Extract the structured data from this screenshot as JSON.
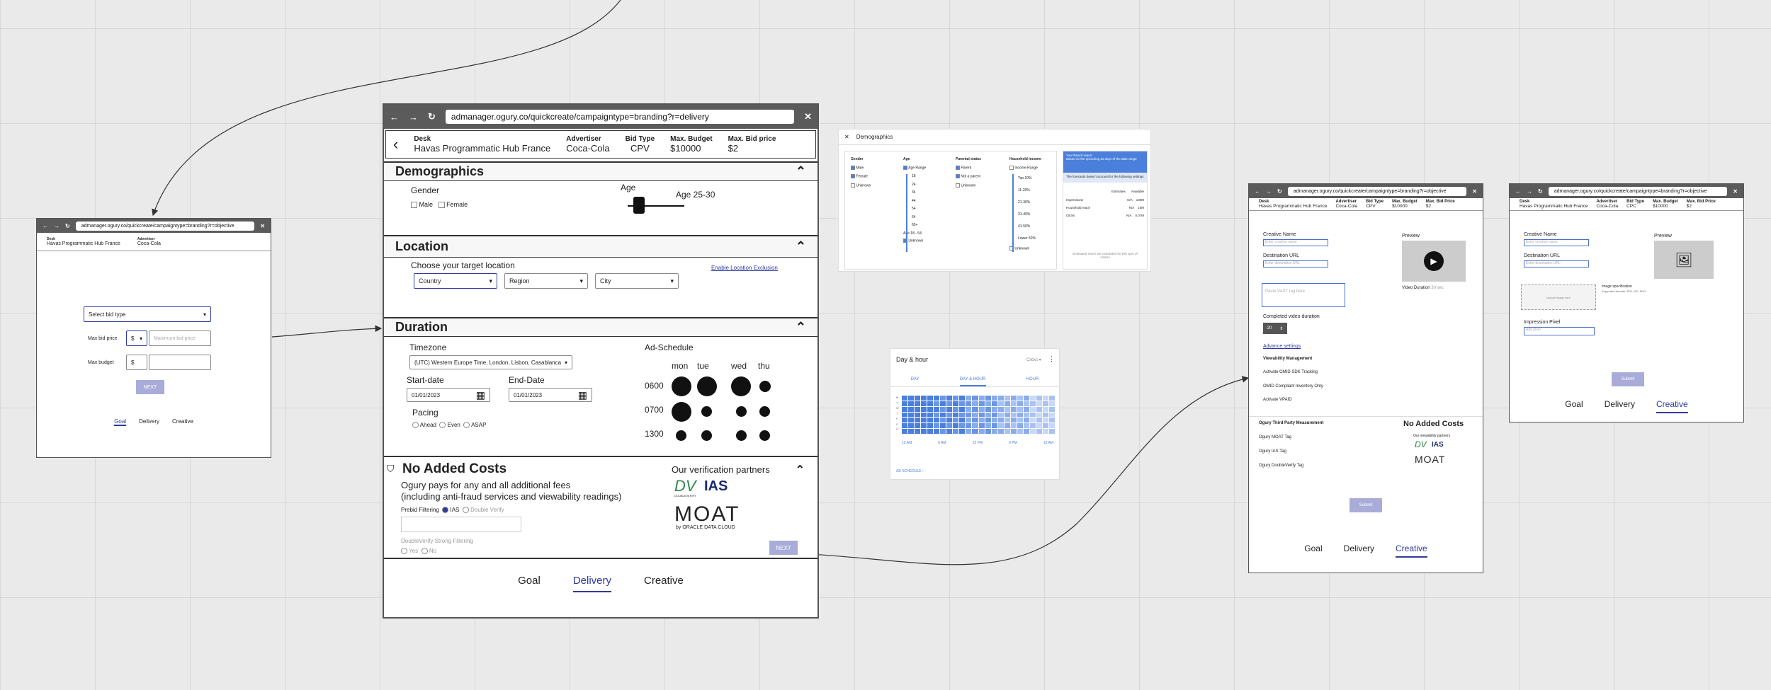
{
  "main": {
    "url": "admanager.ogury.co/quickcreate/campaigntype=branding?r=delivery",
    "header": {
      "desk_label": "Desk",
      "desk": "Havas Programmatic Hub France",
      "adv_label": "Advertiser",
      "adv": "Coca-Cola",
      "bid_label": "Bid Type",
      "bid": "CPV",
      "budget_label": "Max. Budget",
      "budget": "$10000",
      "price_label": "Max. Bid price",
      "price": "$2"
    },
    "demographics": {
      "title": "Demographics",
      "gender_label": "Gender",
      "male": "Male",
      "female": "Female",
      "age_label": "Age",
      "age_value": "Age 25-30"
    },
    "location": {
      "title": "Location",
      "prompt": "Choose your target location",
      "country": "Country",
      "region": "Region",
      "city": "City",
      "exclusion": "Enable Location Exclusion"
    },
    "duration": {
      "title": "Duration",
      "timezone_label": "Timezone",
      "timezone": "(UTC) Western Europe Time, London, Lisbon, Casablanca",
      "start_label": "Start-date",
      "start": "01/01/2023",
      "end_label": "End-Date",
      "end": "01/01/2023",
      "pacing_label": "Pacing",
      "ahead": "Ahead",
      "even": "Even",
      "asap": "ASAP",
      "schedule_label": "Ad-Schedule",
      "days": [
        "mon",
        "tue",
        "wed",
        "thu"
      ],
      "hours": [
        "0600",
        "0700",
        "1300"
      ]
    },
    "costs": {
      "title": "No Added Costs",
      "line1": "Ogury pays for any and all additional fees",
      "line2": "(including anti-fraud services and viewability readings)",
      "prebid_label": "Prebid Filtering",
      "ias": "IAS",
      "dv": "Double Verify",
      "dv_strong": "DoubleVerify Strong Filtering",
      "yes": "Yes",
      "no": "No",
      "partners": "Our verification partners",
      "dv_logo": "DV",
      "ias_logo": "IAS",
      "dv_sub": "DOUBLEVERIFY",
      "moat": "MOAT",
      "moat_sub": "by ORACLE DATA CLOUD",
      "next": "NEXT"
    },
    "tabs": {
      "goal": "Goal",
      "delivery": "Delivery",
      "creative": "Creative"
    }
  },
  "left": {
    "url": "admanager.ogury.co/quickcreate/campaigntype=branding?r=objective",
    "desk_label": "Desk",
    "desk": "Havas Programmatic Hub France",
    "adv_label": "Advertiser",
    "adv": "Coca-Cola",
    "bid_type": "Select bid type",
    "max_bid_label": "Max bid price",
    "currency": "$",
    "max_bid_ph": "Maximum bid price",
    "max_budget_label": "Max budget",
    "next": "NEXT",
    "tabs": {
      "goal": "Goal",
      "delivery": "Delivery",
      "creative": "Creative"
    }
  },
  "demo_panel": {
    "title": "Demographics",
    "gender_h": "Gender",
    "genders": [
      "Male",
      "Female",
      "Unknown"
    ],
    "age_h": "Age",
    "age_range": "Age Range",
    "ages": [
      "18",
      "24",
      "34",
      "44",
      "54",
      "64",
      "65+"
    ],
    "age_summary": "Age 18 - 54",
    "age_unknown": "Unknown",
    "parental_h": "Parental status",
    "parental": [
      "Parent",
      "Not a parent",
      "Unknown"
    ],
    "income_h": "Household income",
    "income_range": "Income Range",
    "incomes": [
      "Top 10%",
      "11-20%",
      "21-30%",
      "31-40%",
      "41-50%",
      "Lower 50%"
    ],
    "income_unknown": "Unknown",
    "reach_title": "Your Reach report",
    "reach_sub": "Based on the upcoming 30 days of the date range",
    "notice": "The forecasts doesn't account for the following settings",
    "col_a": "Estimates",
    "col_b": "Available",
    "reach_rows": [
      [
        "Impressions",
        "N/A",
        "100M"
      ],
      [
        "Household reach",
        "N/A",
        "10M"
      ],
      [
        "Clicks",
        "N/A",
        "0.07M"
      ]
    ],
    "footer": "Estimated reach are calculated for this type of criteria"
  },
  "hour_panel": {
    "title": "Day & hour",
    "select": "Clicks",
    "tabs": [
      "DAY",
      "DAY & HOUR",
      "HOUR"
    ],
    "days": [
      "M",
      "T",
      "W",
      "T",
      "F",
      "S",
      "S"
    ],
    "times": [
      "12 AM",
      "6 AM",
      "12 PM",
      "6 PM",
      "12 AM"
    ],
    "link": "AD SCHEDULE"
  },
  "video_frame": {
    "url": "admanager.ogury.co/quickcreate/campaigntype=branding?r=objective",
    "h": {
      "desk_label": "Desk",
      "desk": "Havas Programmatic Hub France",
      "adv_label": "Advertiser",
      "adv": "Coca-Cola",
      "bid_label": "Bid Type",
      "bid": "CPV",
      "budget_label": "Max. Budget",
      "budget": "$10000",
      "price_label": "Max. Bid Price",
      "price": "$2"
    },
    "creative_name": "Creative Name",
    "creative_ph": "Enter creative name",
    "dest_url": "Destination URL",
    "dest_ph": "Enter destination URL",
    "vast_ph": "Paste VAST tag here",
    "preview": "Preview",
    "video_duration": "Video Duration",
    "duration_val": "30 sec",
    "completed": "Completed video duration",
    "completed_val": "20",
    "advance": "Advance settings",
    "viewability": "Viewability Management",
    "v1": "Activate OMID SDK Tracking",
    "v2": "OMID Compliant Inventory Only",
    "v3": "Activate VPAID",
    "third_party": "Ogury Third Party Measurement",
    "t1": "Ogury MOAT Tag",
    "t2": "Ogury IAS Tag",
    "t3": "Ogury DoubleVerify Tag",
    "no_costs": "No Added Costs",
    "partners": "Our viewability partners",
    "dv_logo": "DV",
    "ias_logo": "IAS",
    "moat": "MOAT",
    "submit": "Submit",
    "tabs": {
      "goal": "Goal",
      "delivery": "Delivery",
      "creative": "Creative"
    }
  },
  "image_frame": {
    "url": "admanager.ogury.co/quickcreate/campaigntype=branding?r=objective",
    "h": {
      "desk_label": "Desk",
      "desk": "Havas Programmatic Hub France",
      "adv_label": "Advertiser",
      "adv": "Coca-Cola",
      "bid_label": "Bid Type",
      "bid": "CPC",
      "budget_label": "Max. Budget",
      "budget": "$10000",
      "price_label": "Max. Bid Price",
      "price": "$2"
    },
    "creative_name": "Creative Name",
    "creative_ph": "Enter creative name",
    "dest_url": "Destination URL",
    "dest_ph": "Enter destination URL",
    "preview": "Preview",
    "upload": "Upload image here",
    "spec": "Image specification",
    "spec_sub": "Supported formats: JPG, GIF, PNG",
    "pixel": "Impression Pixel",
    "pixel_ph": "Add pixel",
    "submit": "Submit",
    "tabs": {
      "goal": "Goal",
      "delivery": "Delivery",
      "creative": "Creative"
    }
  },
  "colors": {
    "accent": "#2e3a9f",
    "bar": "#5b5b5b",
    "button": "#a9acd9",
    "panel_blue": "#4a7fdc"
  }
}
